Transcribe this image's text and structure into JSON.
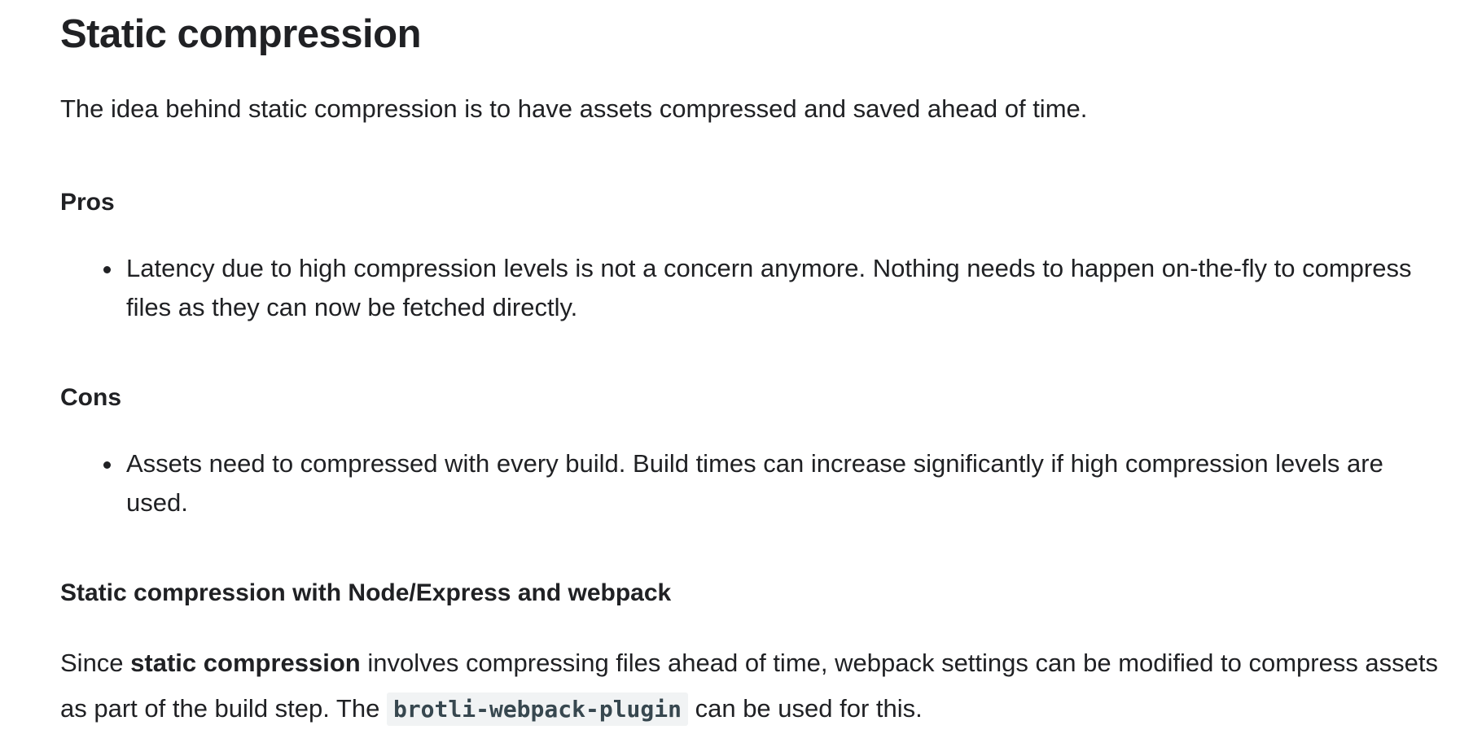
{
  "article": {
    "title": "Static compression",
    "intro": "The idea behind static compression is to have assets compressed and saved ahead of time.",
    "pros": {
      "heading": "Pros",
      "items": [
        "Latency due to high compression levels is not a concern anymore. Nothing needs to happen on-the-fly to compress files as they can now be fetched directly."
      ]
    },
    "cons": {
      "heading": "Cons",
      "items": [
        "Assets need to compressed with every build. Build times can increase significantly if high compression levels are used."
      ]
    },
    "subsection": {
      "heading": "Static compression with Node/Express and webpack",
      "body_prefix": "Since ",
      "body_bold": "static compression",
      "body_middle": " involves compressing files ahead of time, webpack settings can be modified to compress assets as part of the build step. The ",
      "body_code": "brotli-webpack-plugin",
      "body_suffix": " can be used for this."
    }
  }
}
